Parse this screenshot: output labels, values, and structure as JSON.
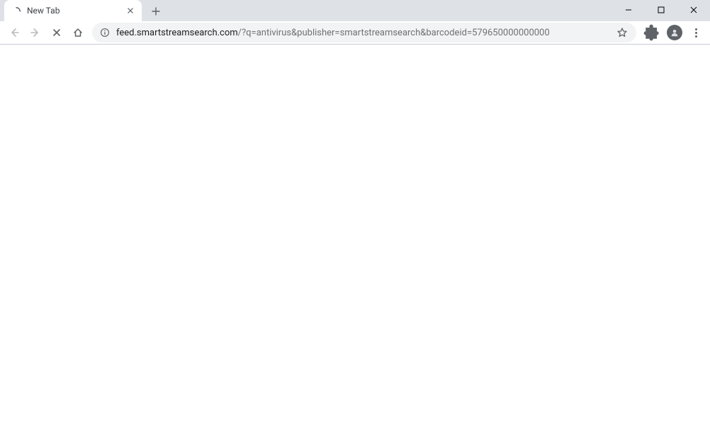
{
  "tab": {
    "title": "New Tab"
  },
  "address": {
    "domain": "feed.smartstreamsearch.com",
    "path": "/?q=antivirus&publisher=smartstreamsearch&barcodeid=579650000000000"
  }
}
